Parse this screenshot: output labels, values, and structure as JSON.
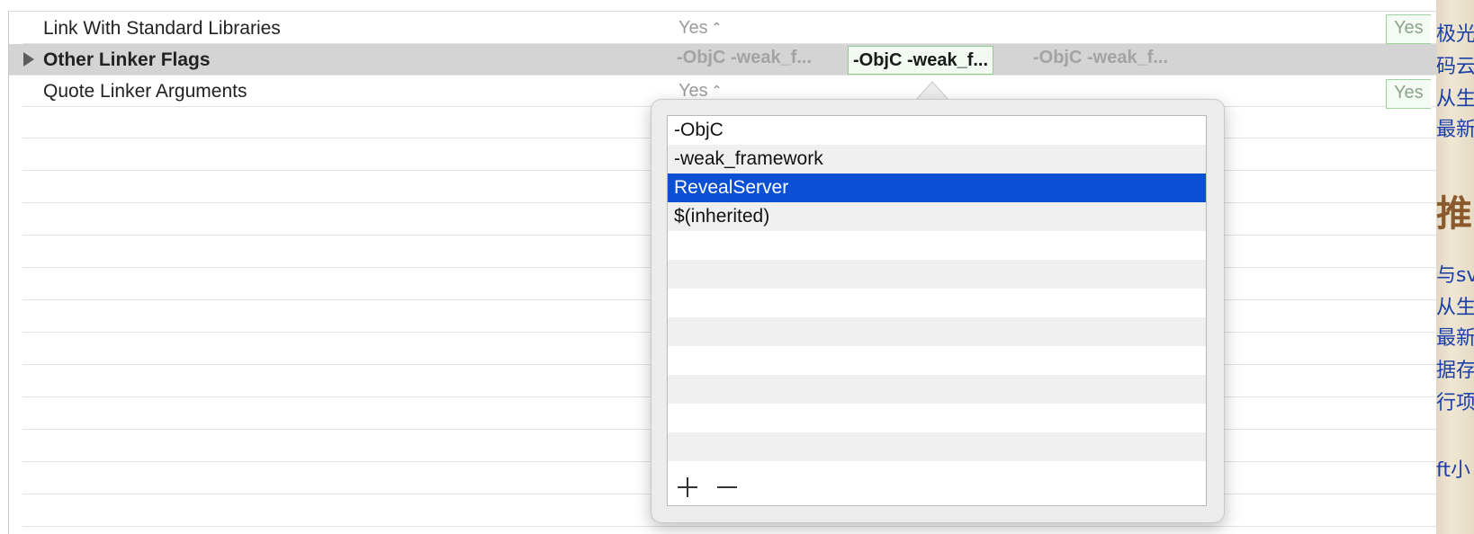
{
  "settings": {
    "rows": [
      {
        "label": "Link With Standard Libraries",
        "value": "Yes",
        "side_value": "Yes"
      },
      {
        "label": "Other Linker Flags",
        "flags": [
          "-ObjC -weak_f...",
          "-ObjC -weak_f...",
          "-ObjC -weak_f..."
        ]
      },
      {
        "label": "Quote Linker Arguments",
        "value": "Yes",
        "side_value": "Yes"
      }
    ]
  },
  "popover": {
    "items": [
      "-ObjC",
      "-weak_framework",
      "RevealServer",
      "$(inherited)"
    ],
    "selected_index": 2,
    "add_label": "+",
    "remove_label": "−"
  },
  "web_strip": {
    "lines": [
      "极光",
      "码云",
      "从生",
      "最新",
      "推",
      "与sv",
      "从生",
      "最新",
      "据存储",
      "行项目",
      "ft小"
    ]
  },
  "colors": {
    "selection": "#0a4fd4",
    "selected_row": "#d4d4d4",
    "link_blue": "#1b3fa8"
  }
}
